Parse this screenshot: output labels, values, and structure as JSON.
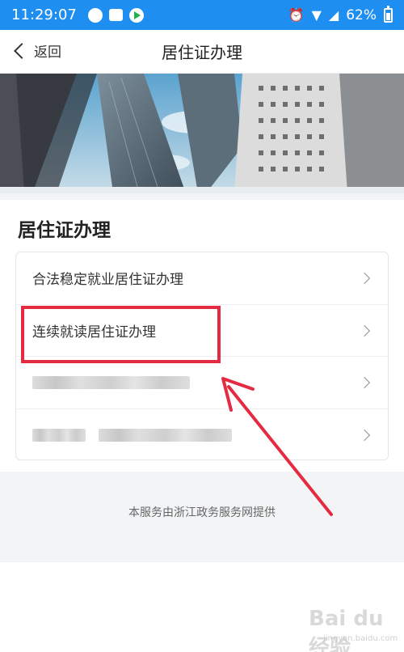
{
  "status_bar": {
    "time": "11:29:07",
    "battery": "62%",
    "battery_level": 0.62,
    "left_icons": [
      "chat-icon",
      "mail-icon",
      "play-icon"
    ],
    "right_icons": [
      "alarm-icon",
      "wifi-icon",
      "signal-icon",
      "battery-icon"
    ]
  },
  "nav": {
    "back_label": "返回",
    "title": "居住证办理"
  },
  "section": {
    "title": "居住证办理",
    "items": [
      {
        "label": "合法稳定就业居住证办理"
      },
      {
        "label": "连续就读居住证办理"
      },
      {
        "label": ""
      },
      {
        "label": ""
      }
    ]
  },
  "footer": {
    "text": "本服务由浙江政务服务网提供"
  },
  "watermark": {
    "text": "Bai du 经验",
    "sub": "jingyan.baidu.com"
  },
  "colors": {
    "status_bar": "#1f8ef1",
    "highlight": "#e42b42",
    "page_bg": "#f2f4f6"
  }
}
